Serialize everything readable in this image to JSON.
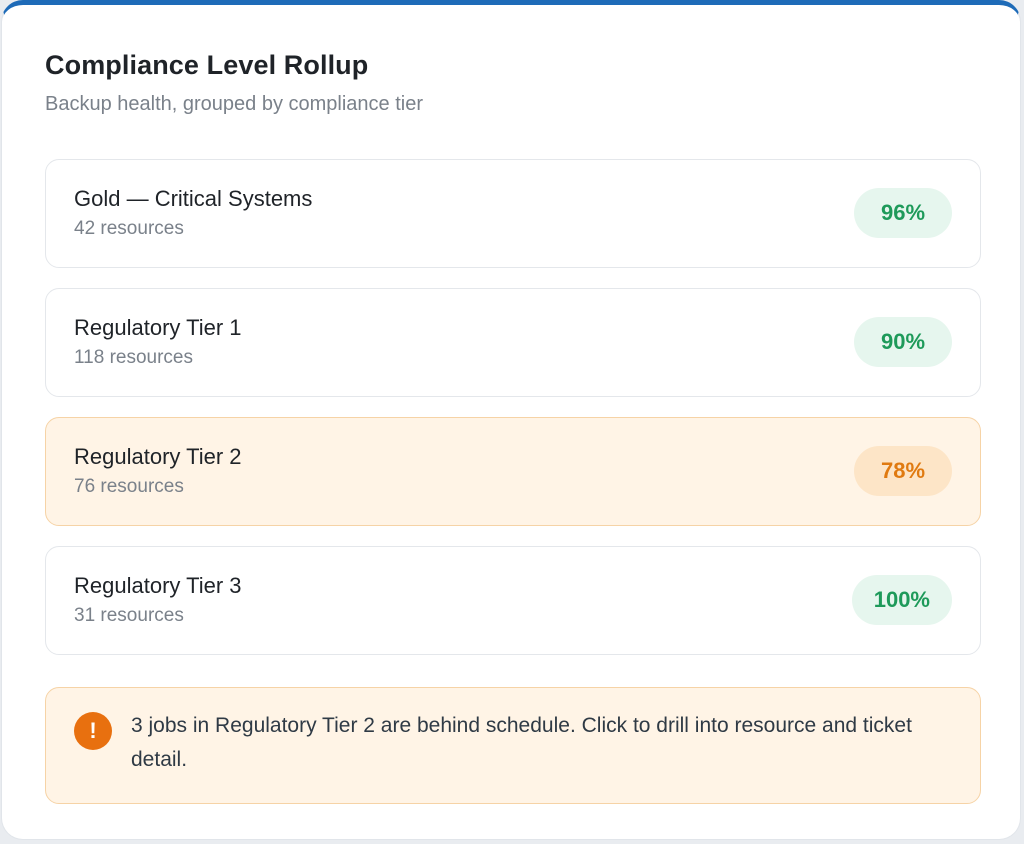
{
  "header": {
    "title": "Compliance Level Rollup",
    "subtitle": "Backup health, grouped by compliance tier"
  },
  "tiers": [
    {
      "name": "Gold — Critical Systems",
      "count": "42 resources",
      "percent": "96%",
      "status": "good"
    },
    {
      "name": "Regulatory Tier 1",
      "count": "118 resources",
      "percent": "90%",
      "status": "good"
    },
    {
      "name": "Regulatory Tier 2",
      "count": "76 resources",
      "percent": "78%",
      "status": "warning"
    },
    {
      "name": "Regulatory Tier 3",
      "count": "31 resources",
      "percent": "100%",
      "status": "good"
    }
  ],
  "alert": {
    "icon": "exclamation-icon",
    "glyph": "!",
    "text": "3 jobs in Regulatory Tier 2 are behind schedule. Click to drill into resource and ticket detail."
  },
  "colors": {
    "accent": "#1e6bb8",
    "good": "#1e9a5a",
    "warning": "#e07a10"
  }
}
